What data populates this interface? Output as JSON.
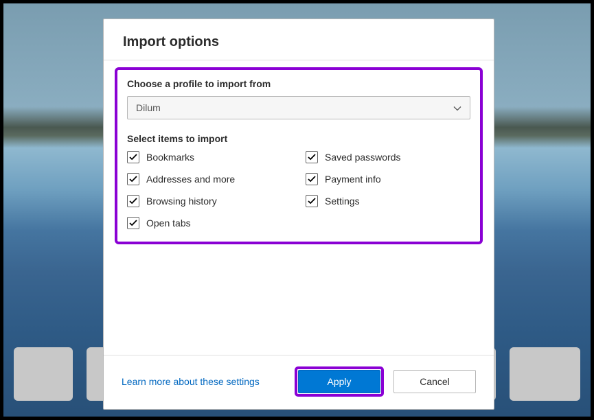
{
  "dialog": {
    "title": "Import options",
    "profile_label": "Choose a profile to import from",
    "profile_selected": "Dilum",
    "items_label": "Select items to import",
    "items": [
      {
        "label": "Bookmarks",
        "checked": true
      },
      {
        "label": "Saved passwords",
        "checked": true
      },
      {
        "label": "Addresses and more",
        "checked": true
      },
      {
        "label": "Payment info",
        "checked": true
      },
      {
        "label": "Browsing history",
        "checked": true
      },
      {
        "label": "Settings",
        "checked": true
      },
      {
        "label": "Open tabs",
        "checked": true
      }
    ],
    "learn_more": "Learn more about these settings",
    "apply": "Apply",
    "cancel": "Cancel"
  },
  "colors": {
    "highlight": "#8a00d4",
    "primary": "#0078d4",
    "link": "#0067c0"
  }
}
